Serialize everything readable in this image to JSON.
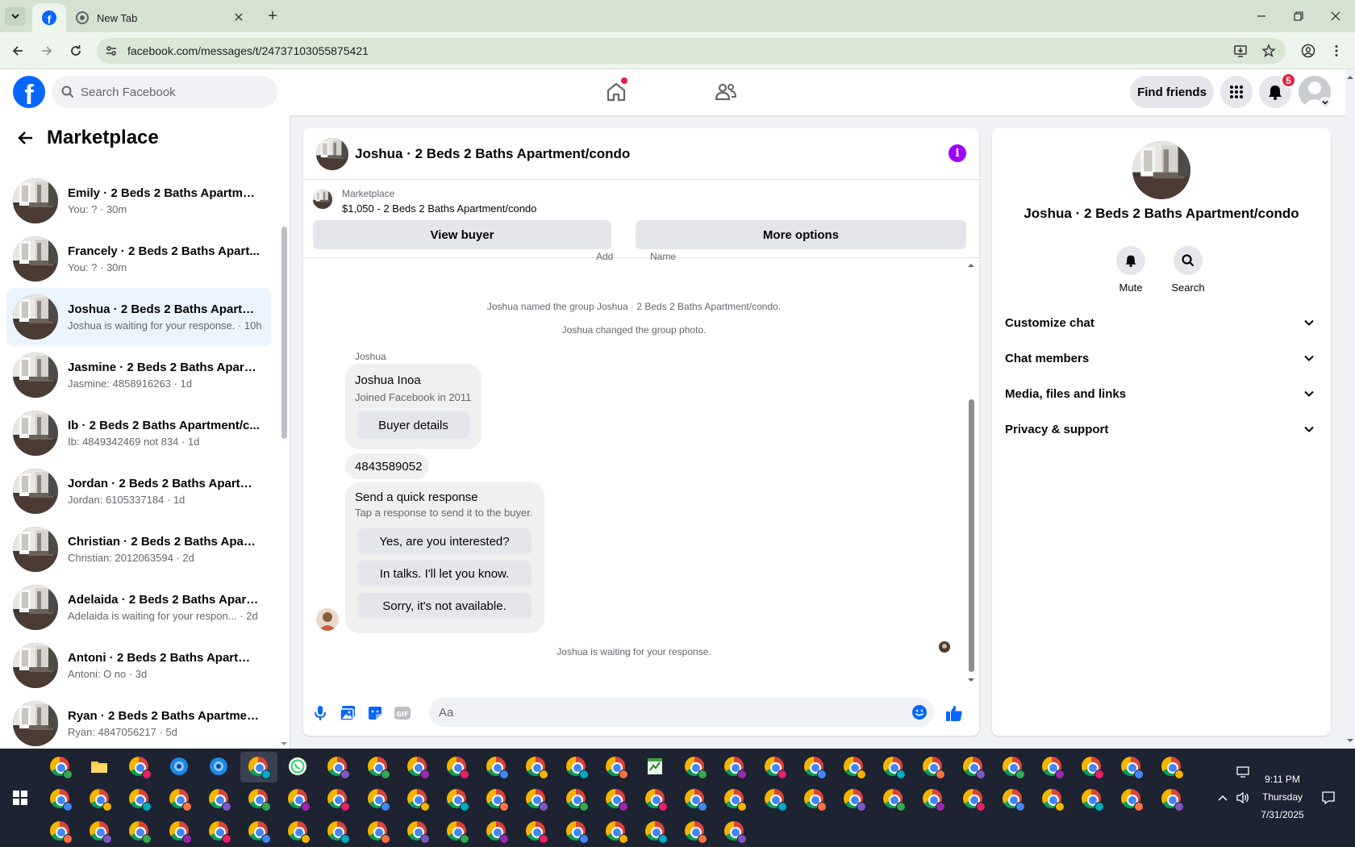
{
  "browser": {
    "tabs": [
      {
        "title": "",
        "icon": "facebook-favicon",
        "active": true
      },
      {
        "title": "New Tab",
        "icon": "chrome-favicon",
        "active": false
      }
    ],
    "url": "facebook.com/messages/t/24737103055875421"
  },
  "header": {
    "search_placeholder": "Search Facebook",
    "find_friends": "Find friends",
    "notification_count": "5"
  },
  "sidebar": {
    "title": "Marketplace",
    "conversations": [
      {
        "name": "Emily · 2 Beds 2 Baths Apartmen...",
        "sub": "You: ? · 30m"
      },
      {
        "name": "Francely · 2 Beds 2 Baths Apart...",
        "sub": "You: ? · 30m"
      },
      {
        "name": "Joshua · 2 Beds 2 Baths Apartm...",
        "sub": "Joshua is waiting for your response. · 10h"
      },
      {
        "name": "Jasmine · 2 Beds 2 Baths Apartm...",
        "sub": "Jasmine: 4858916263 · 1d"
      },
      {
        "name": "Ib · 2 Beds 2 Baths Apartment/c...",
        "sub": "Ib: 4849342469 not 834 · 1d"
      },
      {
        "name": "Jordan · 2 Beds 2 Baths Apartme...",
        "sub": "Jordan: 6105337184 · 1d"
      },
      {
        "name": "Christian · 2 Beds 2 Baths Apart...",
        "sub": "Christian: 2012063594 · 2d"
      },
      {
        "name": "Adelaida · 2 Beds 2 Baths Apart...",
        "sub": "Adelaida is waiting for your respon... · 2d"
      },
      {
        "name": "Antoni · 2 Beds 2 Baths Apartme...",
        "sub": "Antoni: O no · 3d"
      },
      {
        "name": "Ryan · 2 Beds 2 Baths Apartmen...",
        "sub": "Ryan: 4847056217 · 5d"
      }
    ]
  },
  "chat": {
    "title": "Joshua · 2 Beds 2 Baths Apartment/condo",
    "listing_source": "Marketplace",
    "listing_price": "$1,050 - 2 Beds 2 Baths Apartment/condo",
    "view_buyer": "View buyer",
    "more_options": "More options",
    "cutoff_left": "Add",
    "cutoff_right": "Name",
    "system_messages": [
      "Joshua named the group Joshua · 2 Beds 2 Baths Apartment/condo.",
      "Joshua changed the group photo."
    ],
    "sender": "Joshua",
    "card_name": "Joshua Inoa",
    "card_sub": "Joined Facebook in 2011",
    "buyer_details": "Buyer details",
    "phone_message": "4843589052",
    "quick_title": "Send a quick response",
    "quick_sub": "Tap a response to send it to the buyer.",
    "quick_replies": [
      "Yes, are you interested?",
      "In talks. I'll let you know.",
      "Sorry, it's not available."
    ],
    "waiting": "Joshua is waiting for your response.",
    "composer_placeholder": "Aa"
  },
  "info_panel": {
    "name": "Joshua · 2 Beds 2 Baths Apartment/condo",
    "actions": [
      "Mute",
      "Search"
    ],
    "sections": [
      "Customize chat",
      "Chat members",
      "Media, files and links",
      "Privacy & support"
    ]
  },
  "taskbar": {
    "time": "9:11 PM",
    "day": "Thursday",
    "date": "7/31/2025"
  },
  "colors": {
    "facebook_blue": "#0866ff",
    "info_purple": "#a100ff",
    "notification_red": "#e41e3f",
    "active_conversation": "#ebf5ff"
  }
}
